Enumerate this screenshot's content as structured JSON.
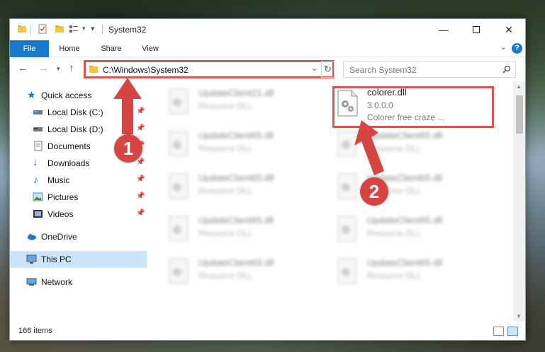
{
  "window": {
    "title": "System32"
  },
  "ribbon": {
    "tabs": [
      "File",
      "Home",
      "Share",
      "View"
    ],
    "help": "?"
  },
  "address": {
    "path": "C:\\Windows\\System32",
    "search_placeholder": "Search System32"
  },
  "sidebar": {
    "items": [
      {
        "label": "Quick access",
        "icon": "star-icon"
      },
      {
        "label": "Local Disk (C:)",
        "icon": "drive-icon",
        "pinned": true
      },
      {
        "label": "Local Disk (D:)",
        "icon": "drive-icon",
        "pinned": true
      },
      {
        "label": "Documents",
        "icon": "document-icon",
        "pinned": true
      },
      {
        "label": "Downloads",
        "icon": "download-icon",
        "pinned": true
      },
      {
        "label": "Music",
        "icon": "music-icon",
        "pinned": true
      },
      {
        "label": "Pictures",
        "icon": "pictures-icon",
        "pinned": true
      },
      {
        "label": "Videos",
        "icon": "video-icon",
        "pinned": true
      },
      {
        "label": "OneDrive",
        "icon": "cloud-icon"
      },
      {
        "label": "This PC",
        "icon": "computer-icon",
        "selected": true
      },
      {
        "label": "Network",
        "icon": "network-icon"
      }
    ]
  },
  "files": {
    "left": [
      {
        "name": "UpdateClient21.dll",
        "desc": "Resource DLL"
      },
      {
        "name": "UpdateClient65.dll",
        "desc": "Resource DLL"
      },
      {
        "name": "UpdateClient65.dll",
        "desc": "Resource DLL"
      },
      {
        "name": "UpdateClient65.dll",
        "desc": "Resource DLL"
      },
      {
        "name": "UpdateClient63.dll",
        "desc": "Resource DLL"
      }
    ],
    "right": [
      {
        "name": "colorer.dll",
        "version": "3.0.0.0",
        "desc": "Colorer free craze ..."
      },
      {
        "name": "UpdateClient65.dll",
        "desc": "Resource DLL"
      },
      {
        "name": "UpdateClient65.dll",
        "desc": "Resource DLL"
      },
      {
        "name": "UpdateClient65.dll",
        "desc": "Resource DLL"
      },
      {
        "name": "UpdateClient65.dll",
        "desc": "Resource DLL"
      }
    ]
  },
  "status": {
    "count": "166 items"
  },
  "annotations": {
    "step1": "1",
    "step2": "2"
  },
  "colors": {
    "accent": "#1979ca",
    "highlight": "#d9534f",
    "selected": "#cce4f7"
  }
}
